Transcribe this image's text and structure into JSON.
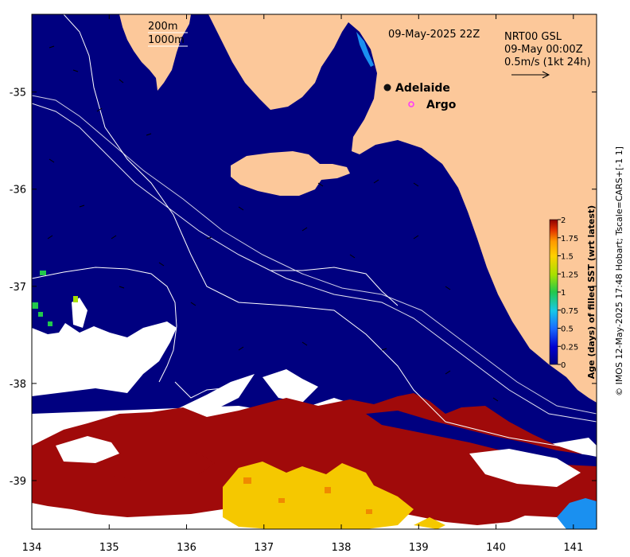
{
  "map": {
    "title_date": "09-May-2025 22Z",
    "product": "NRT00 GSL",
    "current_time": "09-May 00:00Z",
    "current_scale": "0.5m/s (1kt 24h)",
    "depth_legend": [
      "200m",
      "1000m"
    ],
    "places": [
      {
        "name": "Adelaide",
        "marker": "filled-circle"
      },
      {
        "name": "Argo",
        "marker": "open-circle"
      }
    ],
    "lon_ticks": [
      "134",
      "135",
      "136",
      "137",
      "138",
      "139",
      "140",
      "141"
    ],
    "lat_ticks": [
      "-35",
      "-36",
      "-37",
      "-38",
      "-39"
    ],
    "lon_range": [
      134,
      141.3
    ],
    "lat_range": [
      -39.5,
      -34.2
    ],
    "credit": "© IMOS 12-May-2025 17:48 Hobart; Tscale=CARS+[-1 1]"
  },
  "colorbar": {
    "label": "Age (days) of filled SST (wrt latest)",
    "ticks": [
      "0",
      "0.25",
      "0.5",
      "0.75",
      "1",
      "1.25",
      "1.5",
      "1.75",
      "2"
    ],
    "range": [
      0,
      2
    ],
    "colormap": [
      "#000080",
      "#0000d0",
      "#1a6cff",
      "#18c8e8",
      "#22c84c",
      "#a8e000",
      "#ffd000",
      "#ff9a00",
      "#e03000",
      "#8b0000"
    ]
  },
  "colors": {
    "land": "#fcc89a",
    "ocean": "#000080",
    "age_high": "#a00a0a",
    "age_mid": "#f5c800",
    "age_low": "#1a90f0",
    "no_data": "#ffffff",
    "contour": "#ffffff"
  }
}
